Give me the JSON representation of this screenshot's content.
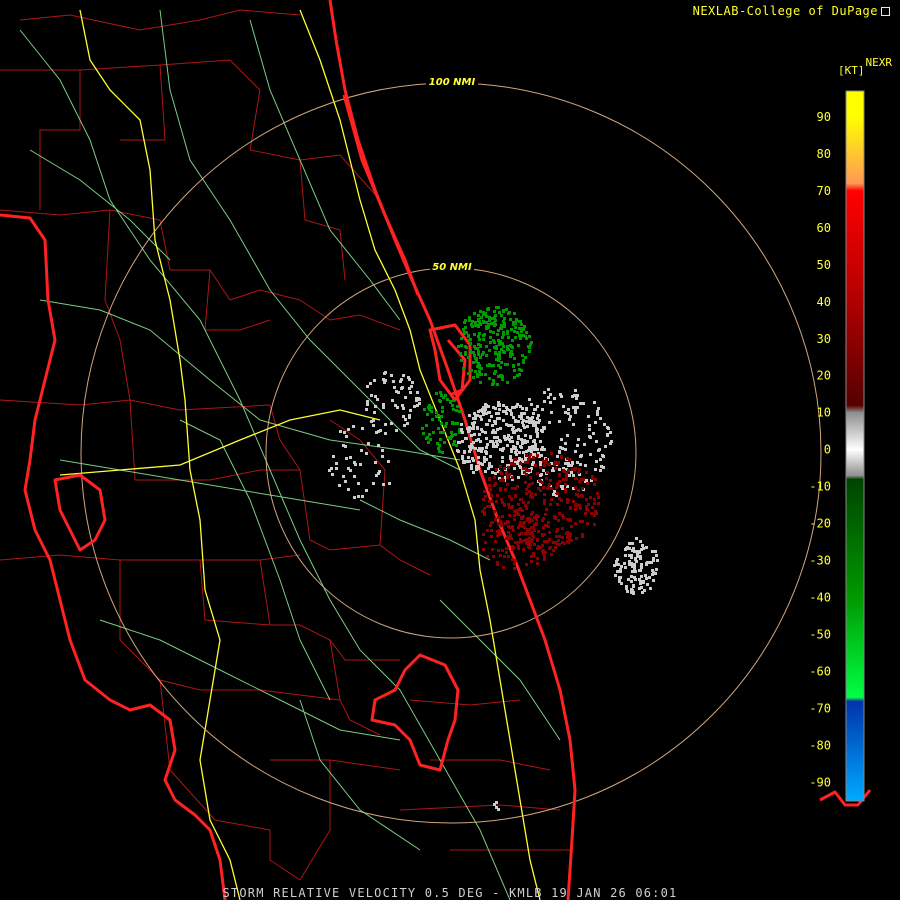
{
  "credit": "NEXLAB-College of DuPage",
  "credit_icon": "external-link-icon",
  "product": "NEXR",
  "unit": "[KT]",
  "footer": "STORM RELATIVE VELOCITY 0.5 DEG - KMLB 19 JAN 26 06:01",
  "rings": [
    {
      "label": "100 NMI"
    },
    {
      "label": "50 NMI"
    }
  ],
  "colorbar": {
    "ticks": [
      "90",
      "80",
      "70",
      "60",
      "50",
      "40",
      "30",
      "20",
      "10",
      "0",
      "-10",
      "-20",
      "-30",
      "-40",
      "-50",
      "-60",
      "-70",
      "-80",
      "-90"
    ],
    "stops": [
      {
        "value": 90,
        "color": "#ffff00"
      },
      {
        "value": 72,
        "color": "#ff9955"
      },
      {
        "value": 70,
        "color": "#ff0000"
      },
      {
        "value": 40,
        "color": "#b00000"
      },
      {
        "value": 12,
        "color": "#550000"
      },
      {
        "value": 10,
        "color": "#909090"
      },
      {
        "value": 0,
        "color": "#ffffff"
      },
      {
        "value": -7,
        "color": "#909090"
      },
      {
        "value": -8,
        "color": "#004400"
      },
      {
        "value": -40,
        "color": "#009900"
      },
      {
        "value": -67,
        "color": "#00ff44"
      },
      {
        "value": -68,
        "color": "#0033aa"
      },
      {
        "value": -95,
        "color": "#00aaff"
      }
    ]
  },
  "colors": {
    "coast": "#ff2222",
    "county": "#d01818",
    "interstate": "#ffff33",
    "roads": "#8ff09a",
    "ring": "#e8b88a",
    "inbound": "#009900",
    "outbound": "#8b0000",
    "near_zero": "#cccccc"
  }
}
